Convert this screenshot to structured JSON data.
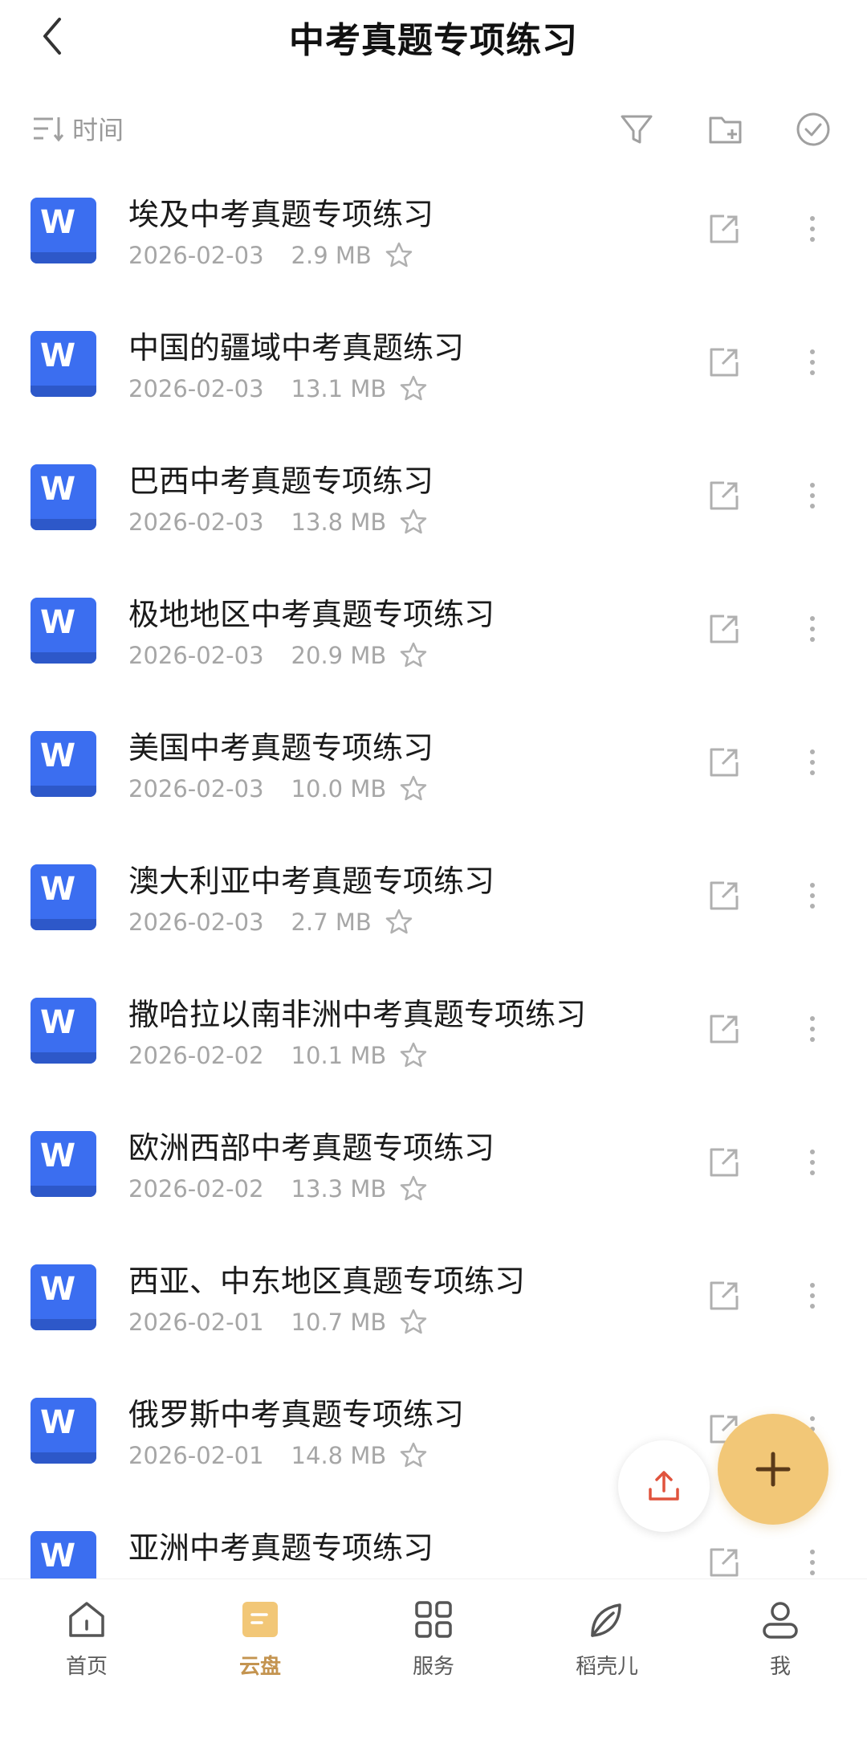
{
  "header": {
    "title": "中考真题专项练习"
  },
  "toolbar": {
    "sort_label": "时间"
  },
  "files": [
    {
      "name": "埃及中考真题专项练习",
      "date": "2026-02-03",
      "size": "2.9 MB",
      "type_letter": "W"
    },
    {
      "name": "中国的疆域中考真题练习",
      "date": "2026-02-03",
      "size": "13.1 MB",
      "type_letter": "W"
    },
    {
      "name": "巴西中考真题专项练习",
      "date": "2026-02-03",
      "size": "13.8 MB",
      "type_letter": "W"
    },
    {
      "name": "极地地区中考真题专项练习",
      "date": "2026-02-03",
      "size": "20.9 MB",
      "type_letter": "W"
    },
    {
      "name": "美国中考真题专项练习",
      "date": "2026-02-03",
      "size": "10.0 MB",
      "type_letter": "W"
    },
    {
      "name": "澳大利亚中考真题专项练习",
      "date": "2026-02-03",
      "size": "2.7 MB",
      "type_letter": "W"
    },
    {
      "name": "撒哈拉以南非洲中考真题专项练习",
      "date": "2026-02-02",
      "size": "10.1 MB",
      "type_letter": "W"
    },
    {
      "name": "欧洲西部中考真题专项练习",
      "date": "2026-02-02",
      "size": "13.3 MB",
      "type_letter": "W"
    },
    {
      "name": "西亚、中东地区真题专项练习",
      "date": "2026-02-01",
      "size": "10.7 MB",
      "type_letter": "W"
    },
    {
      "name": "俄罗斯中考真题专项练习",
      "date": "2026-02-01",
      "size": "14.8 MB",
      "type_letter": "W"
    },
    {
      "name": "亚洲中考真题专项练习",
      "date": "",
      "size": "",
      "type_letter": "W"
    }
  ],
  "tabs": [
    {
      "label": "首页",
      "icon": "home-icon"
    },
    {
      "label": "云盘",
      "icon": "cloud-drive-icon",
      "active": true
    },
    {
      "label": "服务",
      "icon": "grid-icon"
    },
    {
      "label": "稻壳儿",
      "icon": "leaf-icon"
    },
    {
      "label": "我",
      "icon": "user-icon"
    }
  ],
  "colors": {
    "accent": "#c49450",
    "fab": "#f2c777",
    "doc_blue": "#3b6ef0",
    "upload_red": "#e0533d"
  }
}
